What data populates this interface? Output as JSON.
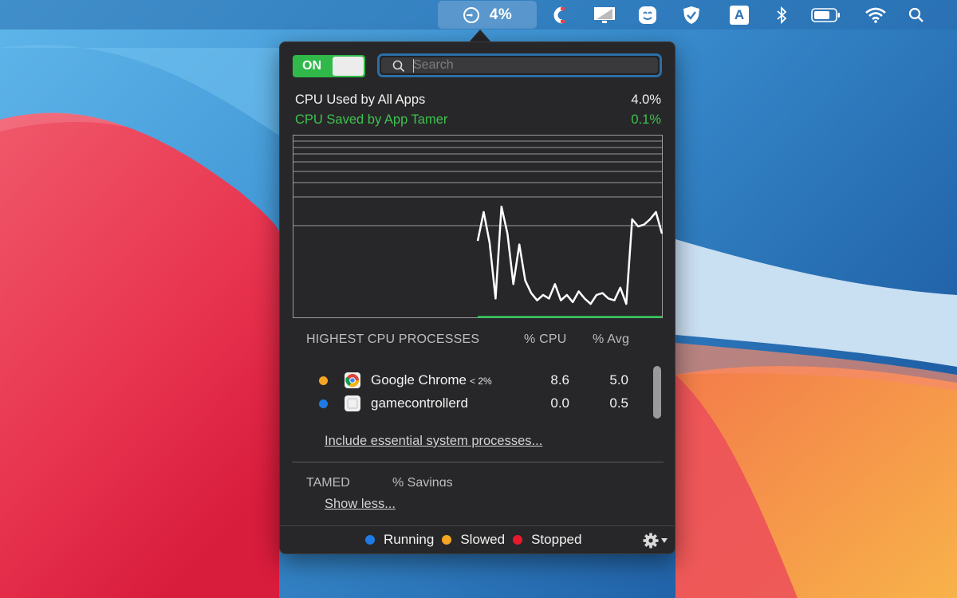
{
  "menubar": {
    "app_tamer_value": "4%",
    "icons": [
      "app-tamer-gauge-icon",
      "magnet-icon",
      "display-icon",
      "robot-face-icon",
      "shield-check-icon",
      "text-input-icon",
      "bluetooth-icon",
      "battery-icon",
      "wifi-icon",
      "spotlight-search-icon"
    ],
    "text_input_letter": "A"
  },
  "toggle": {
    "label": "ON",
    "state": "on"
  },
  "search": {
    "placeholder": "Search",
    "value": ""
  },
  "stats": {
    "used_label": "CPU Used by All Apps",
    "used_value": "4.0%",
    "saved_label": "CPU Saved by App Tamer",
    "saved_value": "0.1%"
  },
  "chart_data": {
    "type": "line",
    "series": [
      {
        "values": [
          0.42,
          0.58,
          0.41,
          0.1,
          0.61,
          0.46,
          0.18,
          0.4,
          0.2,
          0.13,
          0.09,
          0.12,
          0.1,
          0.18,
          0.09,
          0.12,
          0.08,
          0.14,
          0.1,
          0.07,
          0.12,
          0.13,
          0.1,
          0.09,
          0.16,
          0.07,
          0.54,
          0.5,
          0.51,
          0.54,
          0.58,
          0.46
        ]
      }
    ],
    "saved_series": {
      "values": [
        0,
        0,
        0,
        0,
        0,
        0,
        0,
        0,
        0,
        0,
        0,
        0,
        0,
        0,
        0,
        0,
        0,
        0,
        0,
        0,
        0,
        0,
        0,
        0,
        0,
        0,
        0,
        0,
        0,
        0,
        0,
        0
      ]
    },
    "ylim": [
      0,
      1
    ],
    "grid": true,
    "colors": {
      "used": "#ffffff",
      "saved": "#34c759",
      "grid": "#9b9b9d"
    }
  },
  "processes": {
    "header_label": "HIGHEST CPU PROCESSES",
    "col_cpu": "% CPU",
    "col_avg": "% Avg",
    "rows": [
      {
        "name": "Google Chrome",
        "note": "< 2%",
        "cpu": "8.6",
        "avg": "5.0",
        "status": "slowed",
        "icon": "chrome-icon"
      },
      {
        "name": "gamecontrollerd",
        "note": "",
        "cpu": "0.0",
        "avg": "0.5",
        "status": "running",
        "icon": "generic-app-icon"
      }
    ],
    "include_link": "Include essential system processes..."
  },
  "tamed": {
    "header_label": "TAMED",
    "col_savings": "% Savings",
    "show_less_link": "Show less..."
  },
  "legend": {
    "running": "Running",
    "slowed": "Slowed",
    "stopped": "Stopped"
  },
  "colors": {
    "running": "#1f7ae6",
    "slowed": "#f5a623",
    "stopped": "#e8192c",
    "accent_green": "#30b94a"
  }
}
